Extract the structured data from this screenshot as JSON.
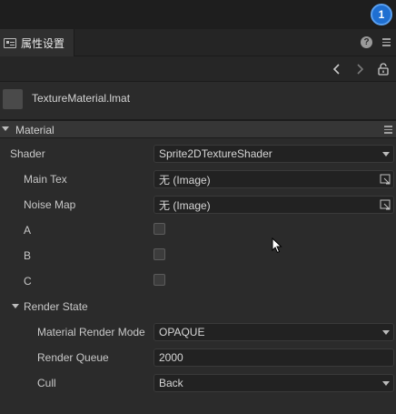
{
  "notification": {
    "count": "1"
  },
  "panel": {
    "tab_label": "属性设置",
    "help_glyph": "?"
  },
  "asset": {
    "name": "TextureMaterial.lmat"
  },
  "material_section": {
    "title": "Material",
    "shader": {
      "label": "Shader",
      "value": "Sprite2DTextureShader"
    },
    "main_tex": {
      "label": "Main Tex",
      "value": "无 (Image)"
    },
    "noise_map": {
      "label": "Noise Map",
      "value": "无 (Image)"
    },
    "flag_a": {
      "label": "A",
      "checked": false
    },
    "flag_b": {
      "label": "B",
      "checked": false
    },
    "flag_c": {
      "label": "C",
      "checked": false
    }
  },
  "render_state": {
    "title": "Render State",
    "render_mode": {
      "label": "Material Render Mode",
      "value": "OPAQUE"
    },
    "render_queue": {
      "label": "Render Queue",
      "value": "2000"
    },
    "cull": {
      "label": "Cull",
      "value": "Back"
    }
  },
  "colors": {
    "background": "#2b2b2b",
    "badge": "#1f6fd1",
    "field": "#222222"
  }
}
